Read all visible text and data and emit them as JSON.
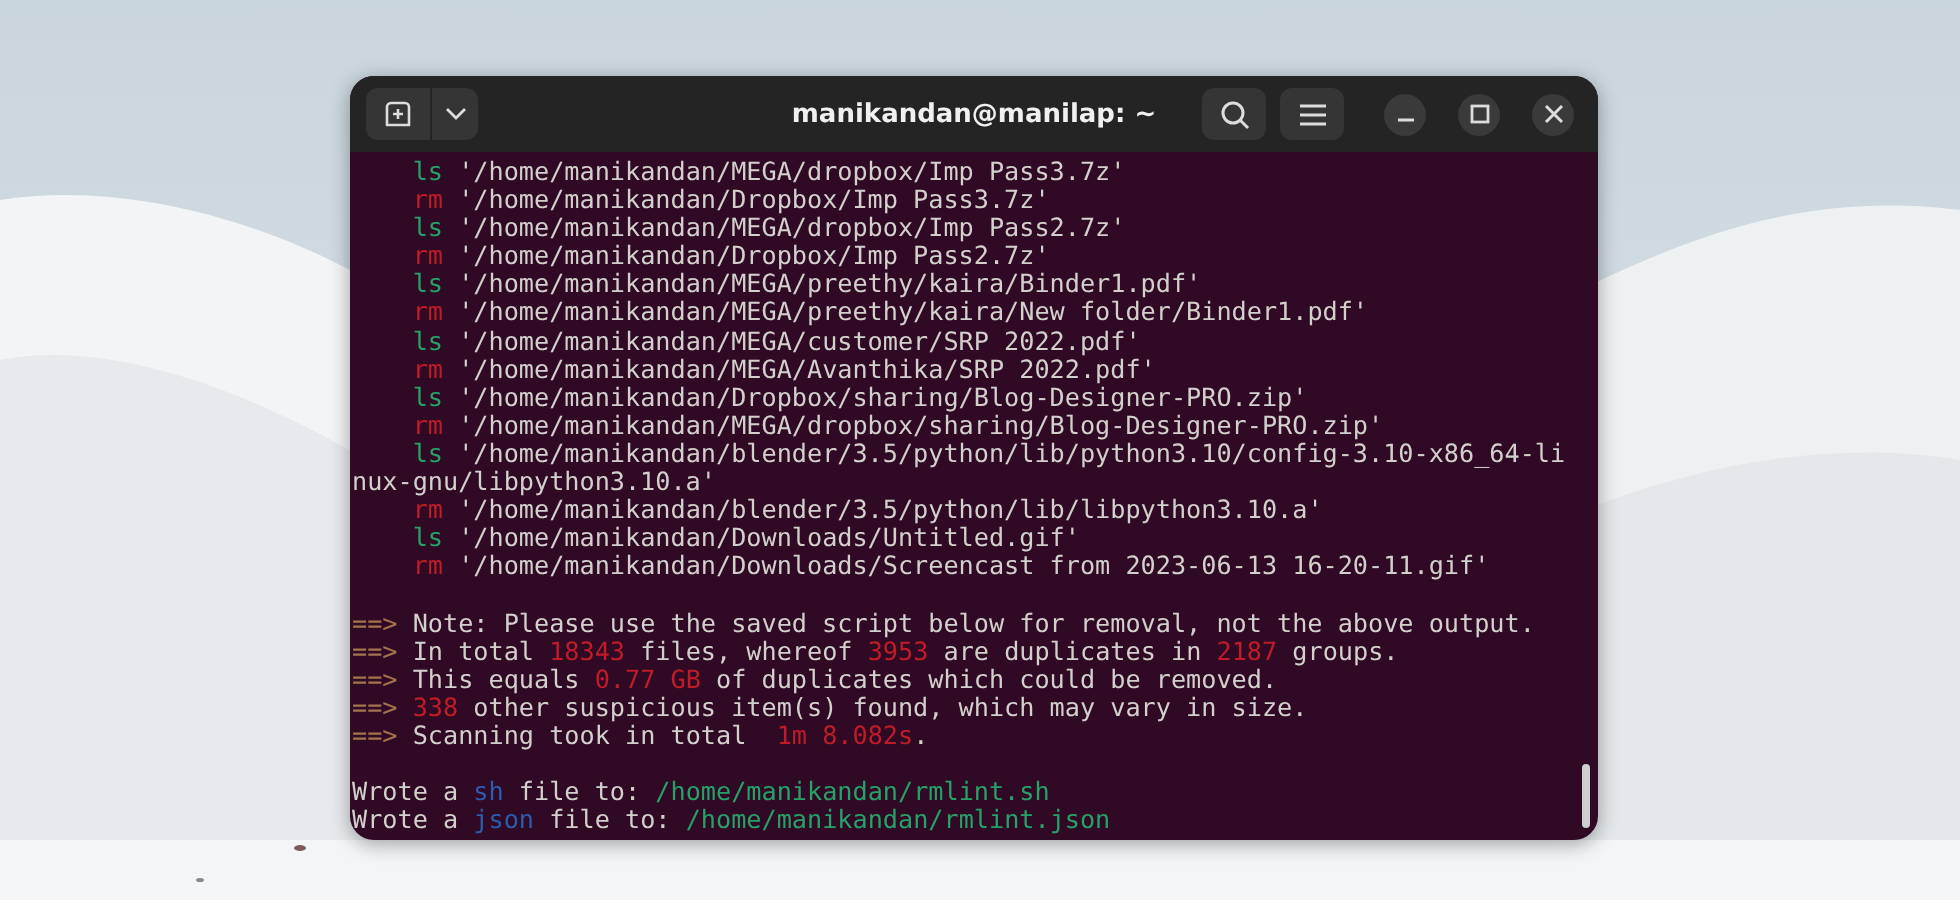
{
  "window": {
    "title": "manikandan@manilap: ~"
  },
  "terminal": {
    "lines": [
      {
        "kind": "keep",
        "tag": "ls",
        "path": "'/home/manikandan/MEGA/dropbox/Imp Pass3.7z'"
      },
      {
        "kind": "remove",
        "tag": "rm",
        "path": "'/home/manikandan/Dropbox/Imp Pass3.7z'"
      },
      {
        "kind": "keep",
        "tag": "ls",
        "path": "'/home/manikandan/MEGA/dropbox/Imp Pass2.7z'"
      },
      {
        "kind": "remove",
        "tag": "rm",
        "path": "'/home/manikandan/Dropbox/Imp Pass2.7z'"
      },
      {
        "kind": "keep",
        "tag": "ls",
        "path": "'/home/manikandan/MEGA/preethy/kaira/Binder1.pdf'"
      },
      {
        "kind": "remove",
        "tag": "rm",
        "path": "'/home/manikandan/MEGA/preethy/kaira/New folder/Binder1.pdf'"
      },
      {
        "kind": "keep",
        "tag": "ls",
        "path": "'/home/manikandan/MEGA/customer/SRP 2022.pdf'"
      },
      {
        "kind": "remove",
        "tag": "rm",
        "path": "'/home/manikandan/MEGA/Avanthika/SRP 2022.pdf'"
      },
      {
        "kind": "keep",
        "tag": "ls",
        "path": "'/home/manikandan/Dropbox/sharing/Blog-Designer-PRO.zip'"
      },
      {
        "kind": "remove",
        "tag": "rm",
        "path": "'/home/manikandan/MEGA/dropbox/sharing/Blog-Designer-PRO.zip'"
      },
      {
        "kind": "keep",
        "tag": "ls",
        "path": "'/home/manikandan/blender/3.5/python/lib/python3.10/config-3.10-x86_64-li"
      },
      {
        "kind": "wrapped",
        "text": "nux-gnu/libpython3.10.a'"
      },
      {
        "kind": "remove",
        "tag": "rm",
        "path": "'/home/manikandan/blender/3.5/python/lib/libpython3.10.a'"
      },
      {
        "kind": "keep",
        "tag": "ls",
        "path": "'/home/manikandan/Downloads/Untitled.gif'"
      },
      {
        "kind": "remove",
        "tag": "rm",
        "path": "'/home/manikandan/Downloads/Screencast from 2023-06-13 16-20-11.gif'"
      },
      {
        "kind": "blank"
      },
      {
        "kind": "summary",
        "marker": "==>",
        "parts": [
          {
            "text": "Note: Please use the saved script below for removal, not the above output.",
            "kind": "plain"
          }
        ]
      },
      {
        "kind": "summary",
        "marker": "==>",
        "parts": [
          {
            "text": "In total ",
            "kind": "plain"
          },
          {
            "text": "18343",
            "kind": "number"
          },
          {
            "text": " files, whereof ",
            "kind": "plain"
          },
          {
            "text": "3953",
            "kind": "number"
          },
          {
            "text": " are duplicates in ",
            "kind": "plain"
          },
          {
            "text": "2187",
            "kind": "number"
          },
          {
            "text": " groups.",
            "kind": "plain"
          }
        ]
      },
      {
        "kind": "summary",
        "marker": "==>",
        "parts": [
          {
            "text": "This equals ",
            "kind": "plain"
          },
          {
            "text": "0.77 GB",
            "kind": "number"
          },
          {
            "text": " of duplicates which could be removed.",
            "kind": "plain"
          }
        ]
      },
      {
        "kind": "summary",
        "marker": "==>",
        "parts": [
          {
            "text": "338",
            "kind": "number"
          },
          {
            "text": " other suspicious item(s) found, which may vary in size.",
            "kind": "plain"
          }
        ]
      },
      {
        "kind": "summary",
        "marker": "==>",
        "parts": [
          {
            "text": "Scanning took in total  ",
            "kind": "plain"
          },
          {
            "text": "1m 8.082s",
            "kind": "number"
          },
          {
            "text": ".",
            "kind": "plain"
          }
        ]
      },
      {
        "kind": "blank"
      },
      {
        "kind": "output",
        "parts": [
          {
            "text": "Wrote a ",
            "kind": "plain"
          },
          {
            "text": "sh",
            "kind": "format"
          },
          {
            "text": " file to: ",
            "kind": "plain"
          },
          {
            "text": "/home/manikandan/rmlint.sh",
            "kind": "path"
          }
        ]
      },
      {
        "kind": "output",
        "parts": [
          {
            "text": "Wrote a ",
            "kind": "plain"
          },
          {
            "text": "json",
            "kind": "format"
          },
          {
            "text": " file to: ",
            "kind": "plain"
          },
          {
            "text": "/home/manikandan/rmlint.json",
            "kind": "path"
          }
        ]
      }
    ]
  }
}
